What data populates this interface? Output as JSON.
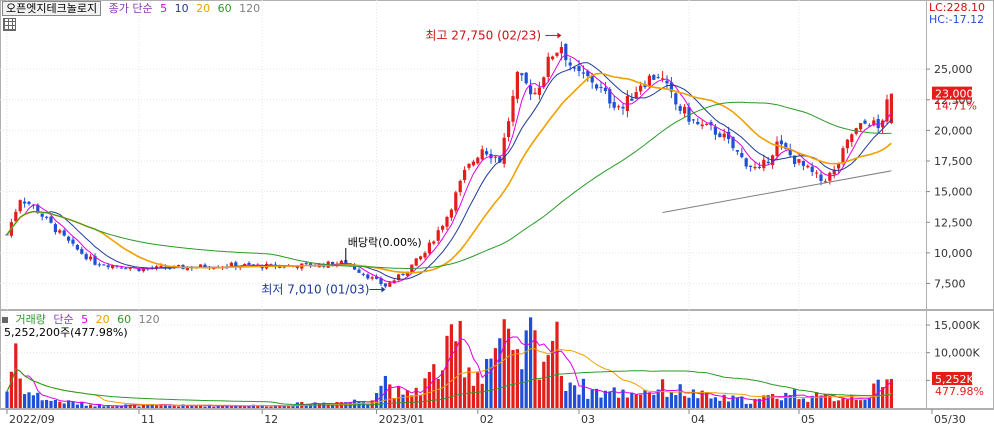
{
  "header": {
    "stock_name": "오픈엣지테크놀로지",
    "price_label": "종가",
    "ma_label": "단순",
    "ma_periods": [
      "5",
      "10",
      "20",
      "60",
      "120"
    ],
    "ma_colors": [
      "#e000e0",
      "#1f3a9a",
      "#f0a000",
      "#2a9a2a",
      "#808080"
    ],
    "lc_text": "LC:228.10",
    "hc_text": "HC:-17.12"
  },
  "volume_header": {
    "label": "거래량",
    "ma_label": "단순",
    "ma_periods": [
      "5",
      "20",
      "60",
      "120"
    ],
    "ma_colors": [
      "#e000e0",
      "#f0a000",
      "#2a9a2a",
      "#808080"
    ],
    "summary": "5,252,200주(477.98%)"
  },
  "annotations": {
    "high": "최고 27,750 (02/23)",
    "low": "최저 7,010 (01/03)",
    "dividend": "배당락(0.00%)"
  },
  "price_badge": {
    "price": "23,000",
    "change": "14.71%"
  },
  "volume_badge": {
    "volume": "5,252K",
    "ratio": "477.98%"
  },
  "colors": {
    "up": "#e31c1c",
    "down": "#1f4fd6",
    "grid": "#e3e3e3",
    "text": "#333333"
  },
  "chart_data": {
    "type": "candlestick",
    "price_axis": {
      "ticks": [
        7500,
        10000,
        12500,
        15000,
        17500,
        20000,
        22500,
        25000
      ],
      "tick_labels": [
        "7,500",
        "10,000",
        "12,500",
        "15,000",
        "17,500",
        "20,000",
        "22,500",
        "25,000"
      ],
      "range": [
        5500,
        29500
      ]
    },
    "volume_axis": {
      "ticks": [
        5000000,
        10000000,
        15000000
      ],
      "tick_labels": [
        "5,000K",
        "10,000K",
        "15,000K"
      ],
      "range": [
        0,
        17000000
      ]
    },
    "x_axis": {
      "labels": [
        "2022/09",
        "11",
        "12",
        "2023/01",
        "02",
        "03",
        "04",
        "05",
        "05/30"
      ],
      "label_index": [
        0,
        30,
        58,
        84,
        107,
        130,
        155,
        180,
        213
      ]
    },
    "price_keypoints": [
      [
        0,
        11500
      ],
      [
        3,
        14500
      ],
      [
        6,
        13800
      ],
      [
        10,
        12300
      ],
      [
        15,
        10500
      ],
      [
        20,
        9200
      ],
      [
        30,
        8700
      ],
      [
        40,
        8800
      ],
      [
        50,
        9000
      ],
      [
        60,
        8900
      ],
      [
        70,
        9000
      ],
      [
        77,
        9200
      ],
      [
        82,
        8100
      ],
      [
        86,
        7300
      ],
      [
        90,
        8300
      ],
      [
        95,
        10000
      ],
      [
        100,
        13000
      ],
      [
        104,
        16500
      ],
      [
        108,
        18600
      ],
      [
        112,
        17600
      ],
      [
        116,
        24200
      ],
      [
        120,
        23100
      ],
      [
        124,
        26300
      ],
      [
        126,
        27000
      ],
      [
        129,
        24600
      ],
      [
        133,
        24100
      ],
      [
        136,
        22800
      ],
      [
        140,
        21800
      ],
      [
        144,
        23900
      ],
      [
        148,
        24600
      ],
      [
        152,
        22100
      ],
      [
        157,
        20400
      ],
      [
        162,
        19800
      ],
      [
        167,
        17700
      ],
      [
        171,
        16600
      ],
      [
        175,
        18900
      ],
      [
        180,
        17300
      ],
      [
        185,
        15900
      ],
      [
        188,
        16600
      ],
      [
        192,
        19700
      ],
      [
        196,
        20800
      ],
      [
        198,
        20100
      ],
      [
        201,
        23000
      ]
    ],
    "volume_keypoints": [
      [
        0,
        3500000
      ],
      [
        1,
        8000000
      ],
      [
        2,
        13000000
      ],
      [
        3,
        6000000
      ],
      [
        5,
        3000000
      ],
      [
        10,
        1500000
      ],
      [
        20,
        600000
      ],
      [
        40,
        500000
      ],
      [
        60,
        500000
      ],
      [
        82,
        1500000
      ],
      [
        86,
        6000000
      ],
      [
        90,
        2000000
      ],
      [
        95,
        5000000
      ],
      [
        100,
        10000000
      ],
      [
        103,
        14000000
      ],
      [
        106,
        6000000
      ],
      [
        110,
        11000000
      ],
      [
        113,
        13000000
      ],
      [
        116,
        8000000
      ],
      [
        119,
        14000000
      ],
      [
        122,
        10000000
      ],
      [
        124,
        15000000
      ],
      [
        127,
        6000000
      ],
      [
        132,
        3500000
      ],
      [
        140,
        3000000
      ],
      [
        150,
        4000000
      ],
      [
        160,
        2000000
      ],
      [
        170,
        1500000
      ],
      [
        178,
        3000000
      ],
      [
        185,
        2000000
      ],
      [
        195,
        2500000
      ],
      [
        201,
        5252200
      ]
    ],
    "projected_trendline": [
      [
        149,
        13300
      ],
      [
        201,
        16700
      ]
    ]
  }
}
